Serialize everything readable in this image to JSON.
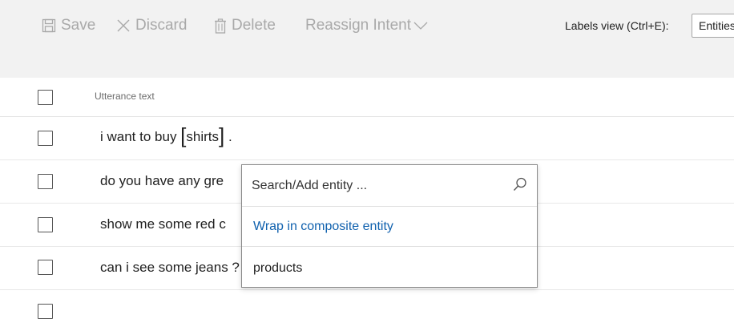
{
  "toolbar": {
    "save_label": "Save",
    "discard_label": "Discard",
    "delete_label": "Delete",
    "reassign_label": "Reassign Intent",
    "labels_view_label": "Labels view (Ctrl+E):",
    "labels_view_value": "Entities"
  },
  "table": {
    "header": "Utterance text",
    "rows": [
      {
        "before": "i want to buy ",
        "entity": "shirts",
        "after": " ."
      },
      {
        "text": "do you have any gre"
      },
      {
        "text": "show me some red c"
      },
      {
        "text": "can i see some jeans ?"
      }
    ]
  },
  "popup": {
    "search_placeholder": "Search/Add entity ...",
    "wrap_label": "Wrap in composite entity",
    "products_label": "products"
  },
  "colors": {
    "toolbar_bg": "#f2f2f2",
    "toolbar_text_disabled": "#a9a9a9",
    "link_blue": "#1061ae"
  }
}
